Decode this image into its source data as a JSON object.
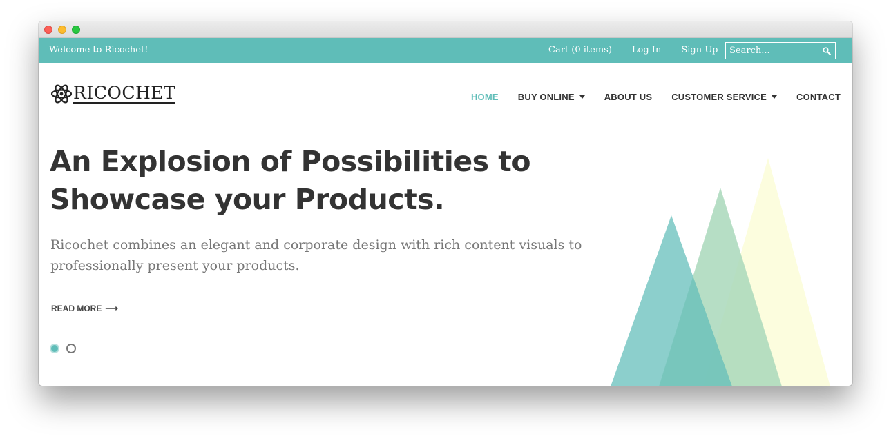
{
  "topbar": {
    "welcome": "Welcome to Ricochet!",
    "links": [
      "Cart (0 items)",
      "Log In",
      "Sign Up"
    ],
    "search_placeholder": "Search..."
  },
  "logo": {
    "text": "RICOCHET"
  },
  "nav": {
    "items": [
      "HOME",
      "BUY ONLINE",
      "ABOUT US",
      "CUSTOMER SERVICE",
      "CONTACT"
    ],
    "active": "HOME"
  },
  "hero": {
    "title_line1": "An Explosion of Possibilities to",
    "title_line2": "Showcase your Products.",
    "description": "Ricochet combines an elegant and corporate design with rich content visuals to professionally present your products.",
    "read_more": "READ MORE",
    "read_more_arrow": "⟶",
    "slides_total": 2,
    "slide_active": 1
  },
  "colors": {
    "accent": "#5fbdb8",
    "triangle_teal": "#5fbdb8",
    "triangle_green": "#a9d8bb",
    "triangle_yellow": "#fcfdda",
    "text_dark": "#333333",
    "text_muted": "#777777"
  },
  "icons": {
    "window_controls": [
      "close-icon",
      "minimize-icon",
      "zoom-icon"
    ],
    "search": "search-icon",
    "logo": "atom-icon",
    "dropdown": "caret-down-icon",
    "read_more": "arrow-right-icon"
  }
}
